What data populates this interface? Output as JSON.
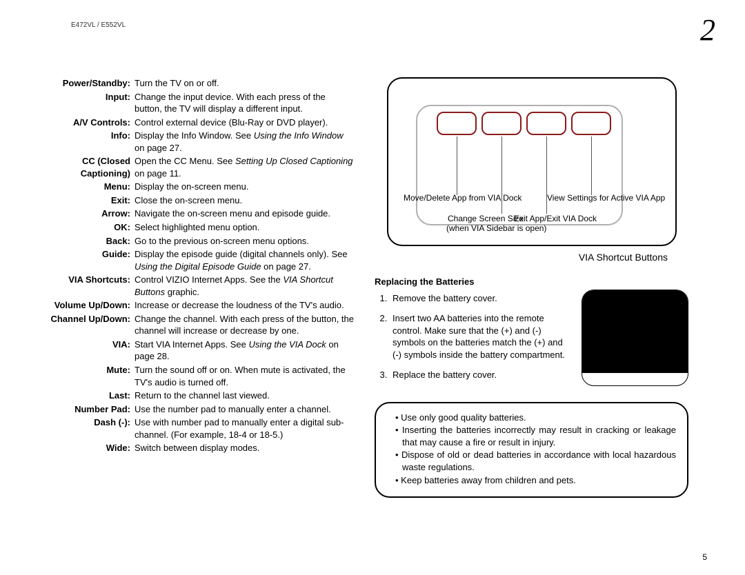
{
  "header": {
    "model": "E472VL / E552VL",
    "page_top": "2"
  },
  "footer": {
    "page_bottom": "5"
  },
  "definitions": [
    {
      "term": "Power/Standby:",
      "desc": "Turn the TV on or off."
    },
    {
      "term": "Input:",
      "desc": "Change the input device. With each press of the button, the TV will display a different input."
    },
    {
      "term": "A/V Controls:",
      "desc": "Control external device (Blu-Ray or DVD player)."
    },
    {
      "term": "Info:",
      "desc": "Display the Info Window. See <em>Using the Info Window</em> on page 27."
    },
    {
      "term": "CC (Closed Captioning)",
      "desc": "Open the CC Menu. See <em>Setting Up Closed Captioning</em> on page 11."
    },
    {
      "term": "Menu:",
      "desc": "Display the on-screen menu."
    },
    {
      "term": "Exit:",
      "desc": "Close the on-screen menu."
    },
    {
      "term": "Arrow:",
      "desc": "Navigate the on-screen menu and episode guide."
    },
    {
      "term": "OK:",
      "desc": "Select highlighted menu option."
    },
    {
      "term": "Back:",
      "desc": "Go to the previous on-screen menu options."
    },
    {
      "term": "Guide:",
      "desc": "Display the episode guide (digital channels only). See <em>Using the Digital Episode Guide</em> on page 27."
    },
    {
      "term": "VIA Shortcuts:",
      "desc": "Control VIZIO Internet Apps. See the <em>VIA Shortcut Buttons</em> graphic."
    },
    {
      "term": "Volume Up/Down:",
      "desc": "Increase or decrease the loudness of the TV's audio."
    },
    {
      "term": "Channel Up/Down:",
      "desc": "Change the channel. With each press of the button, the channel will increase or decrease by one."
    },
    {
      "term": "VIA:",
      "desc": "Start VIA Internet Apps. See <em>Using the VIA Dock</em> on page 28."
    },
    {
      "term": "Mute:",
      "desc": "Turn the sound off or on. When mute is activated, the TV's audio is turned off."
    },
    {
      "term": "Last:",
      "desc": "Return to the channel last viewed."
    },
    {
      "term": "Number Pad:",
      "desc": "Use the number pad to manually enter a channel."
    },
    {
      "term": "Dash (-):",
      "desc": "Use with number pad to manually enter a digital sub-channel. (For example, 18-4 or 18-5.)"
    },
    {
      "term": "Wide:",
      "desc": "Switch between display modes."
    }
  ],
  "via_diagram": {
    "label1": "Move/Delete App from VIA Dock",
    "label2a": "Change Screen Size",
    "label2b": "(when VIA Sidebar is open)",
    "label3": "Exit App/Exit VIA Dock",
    "label4": "View Settings for Active VIA App",
    "caption": "VIA Shortcut Buttons"
  },
  "batteries": {
    "heading": "Replacing the Batteries",
    "steps": [
      "Remove the battery cover.",
      "Insert two AA batteries into the remote control. Make sure that the (+) and (-) symbols on the batteries match the (+) and (-) symbols inside the battery compartment.",
      "Replace the battery cover."
    ]
  },
  "warnings": [
    "Use only good quality batteries.",
    "Inserting the batteries incorrectly may result in cracking or leakage that may cause a fire or result in injury.",
    "Dispose of old or dead batteries in accordance with local hazardous waste regulations.",
    "Keep batteries away from children and pets."
  ]
}
